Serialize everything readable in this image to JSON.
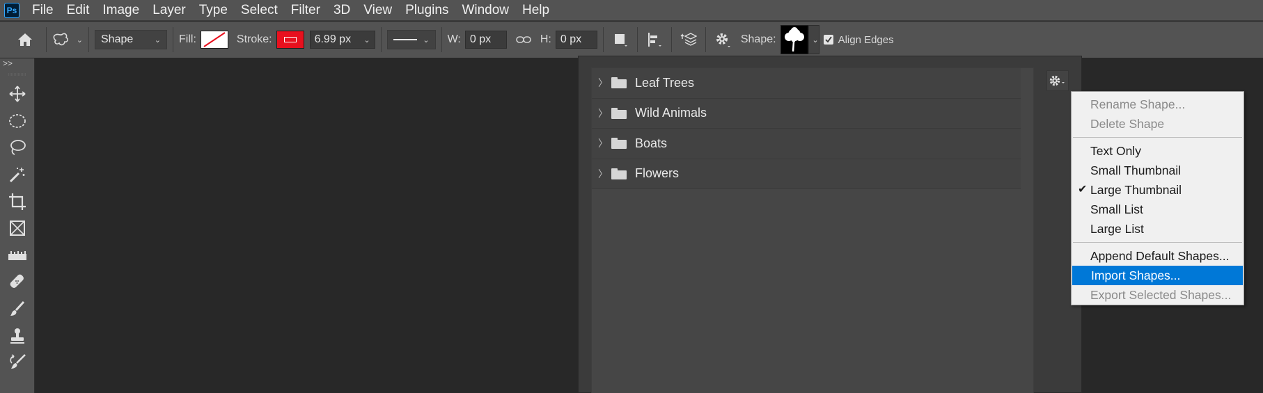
{
  "menubar": {
    "logo": "Ps",
    "items": [
      "File",
      "Edit",
      "Image",
      "Layer",
      "Type",
      "Select",
      "Filter",
      "3D",
      "View",
      "Plugins",
      "Window",
      "Help"
    ]
  },
  "options": {
    "mode_value": "Shape",
    "fill_label": "Fill:",
    "stroke_label": "Stroke:",
    "stroke_width": "6.99 px",
    "w_label": "W:",
    "w_value": "0 px",
    "h_label": "H:",
    "h_value": "0 px",
    "shape_label": "Shape:",
    "align_edges_label": "Align Edges",
    "align_edges_checked": true,
    "stroke_color": "#e8101e"
  },
  "toolbar": {
    "collapse": ">>",
    "tools": [
      "move-tool-icon",
      "elliptical-marquee-icon",
      "lasso-icon",
      "magic-wand-icon",
      "crop-icon",
      "frame-icon",
      "ruler-icon",
      "healing-brush-icon",
      "brush-icon",
      "clone-stamp-icon",
      "history-brush-icon"
    ]
  },
  "shape_panel": {
    "groups": [
      {
        "label": "Leaf Trees"
      },
      {
        "label": "Wild Animals"
      },
      {
        "label": "Boats"
      },
      {
        "label": "Flowers"
      }
    ]
  },
  "flyout": {
    "items": [
      {
        "label": "Rename Shape...",
        "state": "disabled"
      },
      {
        "label": "Delete Shape",
        "state": "disabled"
      },
      {
        "label": "Text Only",
        "state": "normal"
      },
      {
        "label": "Small Thumbnail",
        "state": "normal"
      },
      {
        "label": "Large Thumbnail",
        "state": "checked"
      },
      {
        "label": "Small List",
        "state": "normal"
      },
      {
        "label": "Large List",
        "state": "normal"
      },
      {
        "label": "Append Default Shapes...",
        "state": "normal"
      },
      {
        "label": "Import Shapes...",
        "state": "highlight"
      },
      {
        "label": "Export Selected Shapes...",
        "state": "disabled"
      }
    ],
    "highlight_color": "#0078d7"
  }
}
